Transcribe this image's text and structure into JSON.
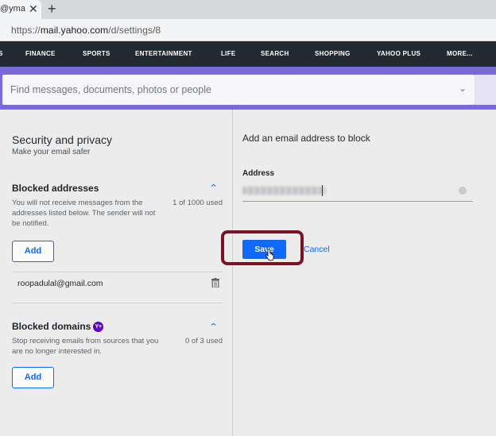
{
  "browser": {
    "tab_title": "@yma",
    "tab_close": "✕",
    "new_tab": "+",
    "url_prefix": "https://",
    "url_host": "mail.yahoo.com",
    "url_path": "/d/settings/8"
  },
  "topnav": {
    "items": [
      "S",
      "FINANCE",
      "SPORTS",
      "ENTERTAINMENT",
      "LIFE",
      "SEARCH",
      "SHOPPING",
      "YAHOO PLUS",
      "MORE..."
    ]
  },
  "search": {
    "placeholder": "Find messages, documents, photos or people"
  },
  "settings": {
    "title": "Security and privacy",
    "subtitle": "Make your email safer",
    "blocked_addresses": {
      "heading": "Blocked addresses",
      "description": "You will not receive messages from the addresses listed below. The sender will not be notified.",
      "usage": "1 of 1000 used",
      "add_label": "Add",
      "entries": [
        "roopadulal@gmail.com"
      ]
    },
    "blocked_domains": {
      "heading": "Blocked domains",
      "badge": "Y+",
      "description": "Stop receiving emails from sources that you are no longer interested in.",
      "usage": "0 of 3 used",
      "add_label": "Add"
    }
  },
  "block_form": {
    "title": "Add an email address to block",
    "address_label": "Address",
    "save_label": "Save",
    "cancel_label": "Cancel"
  },
  "colors": {
    "accent": "#0f69ff",
    "nav_bg": "#232a31",
    "search_band": "#7b68d9",
    "highlight_ring": "#7a1422",
    "plus_badge": "#6001d2"
  }
}
